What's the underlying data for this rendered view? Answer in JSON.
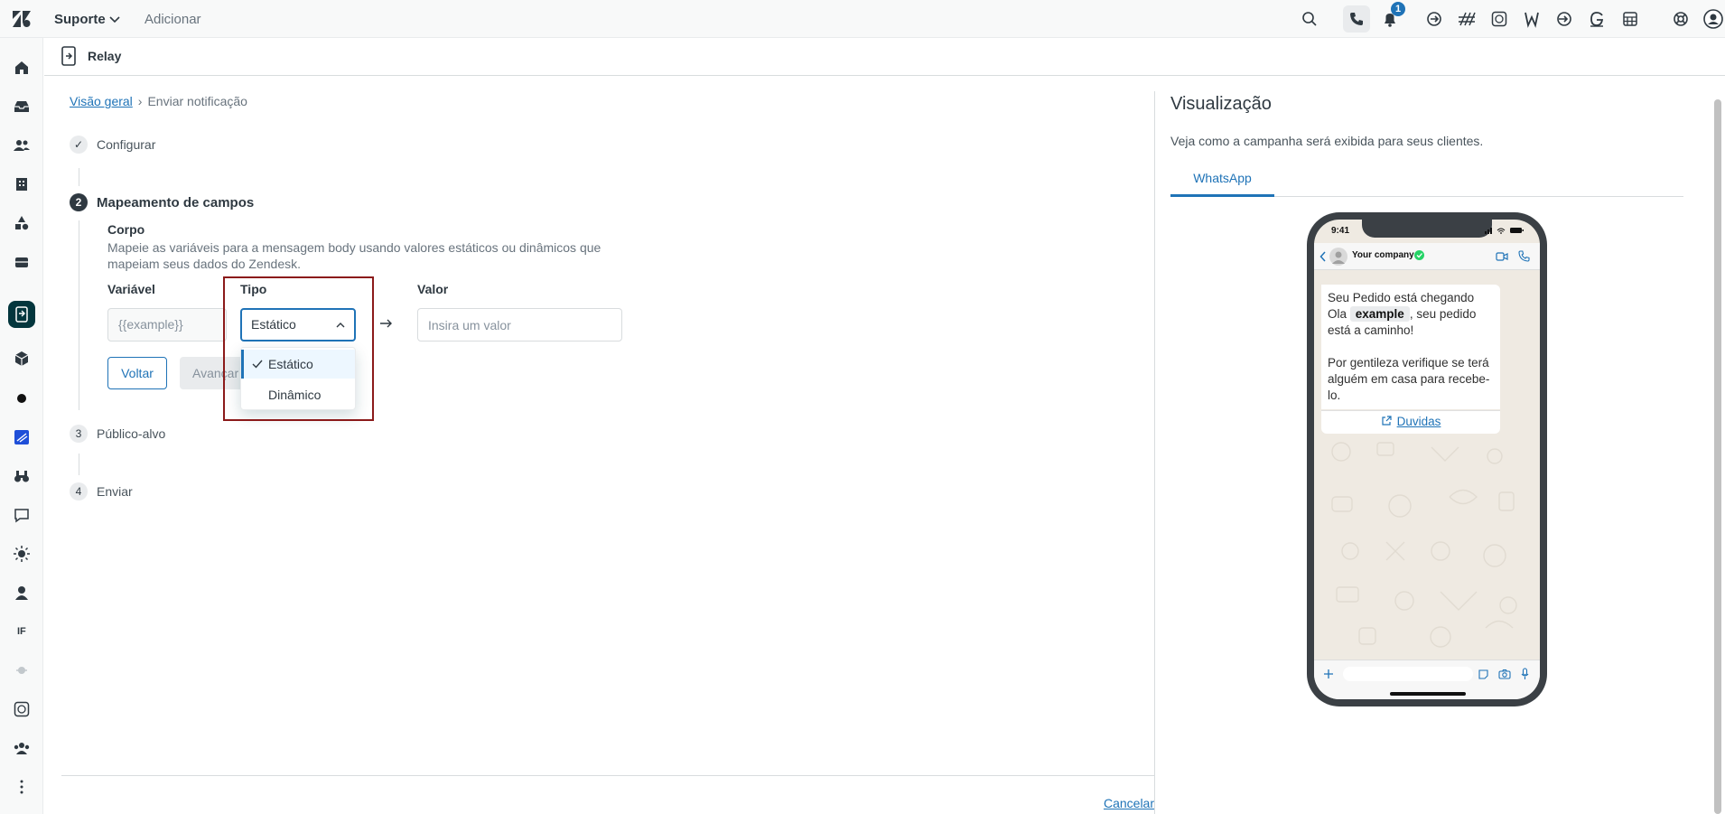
{
  "topbar": {
    "product": "Suporte",
    "add_label": "Adicionar",
    "notification_count": "1"
  },
  "sidebar": {
    "if_label": "IF"
  },
  "app": {
    "title": "Relay"
  },
  "breadcrumb": {
    "overview": "Visão geral",
    "current": "Enviar notificação"
  },
  "steps": [
    {
      "num": "✓",
      "label": "Configurar"
    },
    {
      "num": "2",
      "label": "Mapeamento de campos"
    },
    {
      "num": "3",
      "label": "Público-alvo"
    },
    {
      "num": "4",
      "label": "Enviar"
    }
  ],
  "mapping": {
    "section_title": "Corpo",
    "section_desc": "Mapeie as variáveis para a mensagem body usando valores estáticos ou dinâmicos que mapeiam seus dados do Zendesk.",
    "col_variable": "Variável",
    "col_type": "Tipo",
    "col_value": "Valor",
    "variable_value": "{{example}}",
    "type_selected": "Estático",
    "value_placeholder": "Insira um valor",
    "back_label": "Voltar",
    "next_label": "Avançar",
    "options": [
      "Estático",
      "Dinâmico"
    ]
  },
  "footer": {
    "cancel_label": "Cancelar"
  },
  "preview": {
    "title": "Visualização",
    "description": "Veja como a campanha será exibida para seus clientes.",
    "tab": "WhatsApp",
    "time": "9:41",
    "company": "Your company",
    "msg_line1": "Seu Pedido está chegando",
    "msg_line2a": "Ola ",
    "msg_var": "example",
    "msg_line2b": ", seu pedido está a caminho!",
    "msg_line3": "Por gentileza verifique se terá alguém em casa para recebe-lo.",
    "link_label": "Duvidas"
  }
}
